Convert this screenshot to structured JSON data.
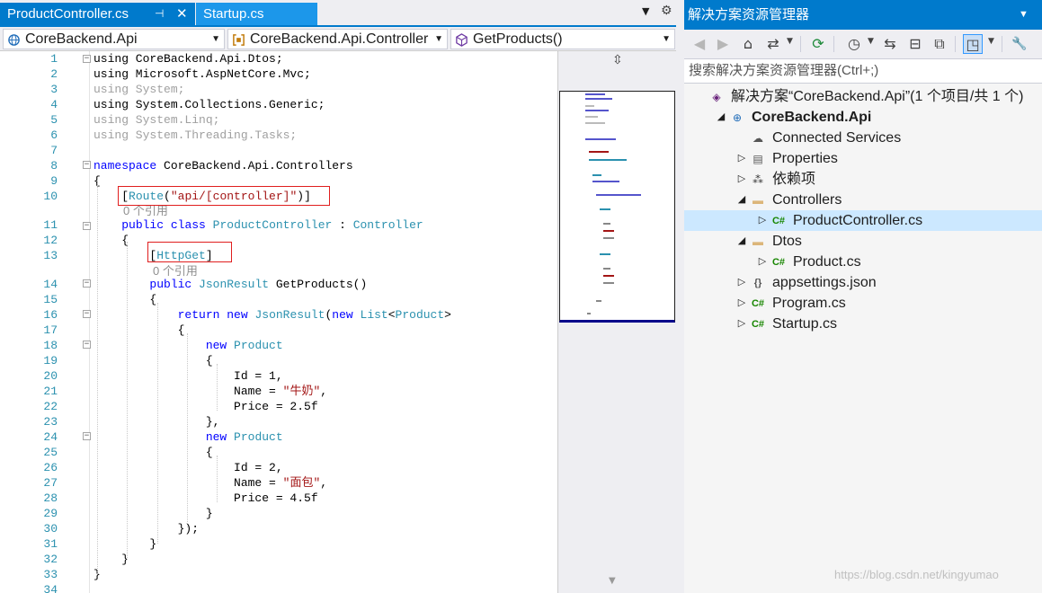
{
  "tabs": {
    "active": "ProductController.cs",
    "second": "Startup.cs",
    "pin_glyph": "⊣",
    "close_glyph": "✕",
    "dropdown_glyph": "▼",
    "gear_glyph": "⚙"
  },
  "navbar": {
    "project": "CoreBackend.Api",
    "namespace": "CoreBackend.Api.Controller",
    "member": "GetProducts()",
    "arrow": "▼"
  },
  "editor": {
    "lines": [
      {
        "n": "1",
        "segs": [
          [
            "using CoreBackend.Api.Dtos;",
            ""
          ]
        ]
      },
      {
        "n": "2",
        "segs": [
          [
            "using Microsoft.AspNetCore.Mvc;",
            ""
          ]
        ]
      },
      {
        "n": "3",
        "segs": [
          [
            "using System;",
            "dim"
          ]
        ]
      },
      {
        "n": "4",
        "segs": [
          [
            "using System.Collections.Generic;",
            ""
          ]
        ]
      },
      {
        "n": "5",
        "segs": [
          [
            "using System.Linq;",
            "dim"
          ]
        ]
      },
      {
        "n": "6",
        "segs": [
          [
            "using System.Threading.Tasks;",
            "dim"
          ]
        ]
      },
      {
        "n": "7",
        "segs": []
      },
      {
        "n": "8",
        "segs": [
          [
            "namespace",
            "kw"
          ],
          [
            " CoreBackend.Api.Controllers",
            ""
          ]
        ]
      },
      {
        "n": "9",
        "segs": [
          [
            "{",
            ""
          ]
        ]
      },
      {
        "n": "10",
        "segs": [
          [
            "    [",
            ""
          ],
          [
            "Route",
            "ty"
          ],
          [
            "(",
            ""
          ],
          [
            "\"api/[controller]\"",
            "st"
          ],
          [
            ")]",
            ""
          ]
        ]
      },
      {
        "n": "11",
        "segs": [
          [
            "    ",
            ""
          ],
          [
            "public",
            "kw"
          ],
          [
            " ",
            ""
          ],
          [
            "class",
            "kw"
          ],
          [
            " ",
            ""
          ],
          [
            "ProductController",
            "ty"
          ],
          [
            " : ",
            ""
          ],
          [
            "Controller",
            "ty"
          ]
        ]
      },
      {
        "n": "12",
        "segs": [
          [
            "    {",
            ""
          ]
        ]
      },
      {
        "n": "13",
        "segs": [
          [
            "        [",
            ""
          ],
          [
            "HttpGet",
            "ty"
          ],
          [
            "]",
            ""
          ]
        ]
      },
      {
        "n": "14",
        "segs": [
          [
            "        ",
            ""
          ],
          [
            "public",
            "kw"
          ],
          [
            " ",
            ""
          ],
          [
            "JsonResult",
            "ty"
          ],
          [
            " GetProducts()",
            ""
          ]
        ]
      },
      {
        "n": "15",
        "segs": [
          [
            "        {",
            ""
          ]
        ]
      },
      {
        "n": "16",
        "segs": [
          [
            "            ",
            ""
          ],
          [
            "return",
            "kw"
          ],
          [
            " ",
            ""
          ],
          [
            "new",
            "kw"
          ],
          [
            " ",
            ""
          ],
          [
            "JsonResult",
            "ty"
          ],
          [
            "(",
            ""
          ],
          [
            "new",
            "kw"
          ],
          [
            " ",
            ""
          ],
          [
            "List",
            "ty"
          ],
          [
            "<",
            ""
          ],
          [
            "Product",
            "ty"
          ],
          [
            ">",
            ""
          ]
        ]
      },
      {
        "n": "17",
        "segs": [
          [
            "            {",
            ""
          ]
        ]
      },
      {
        "n": "18",
        "segs": [
          [
            "                ",
            ""
          ],
          [
            "new",
            "kw"
          ],
          [
            " ",
            ""
          ],
          [
            "Product",
            "ty"
          ]
        ]
      },
      {
        "n": "19",
        "segs": [
          [
            "                {",
            ""
          ]
        ]
      },
      {
        "n": "20",
        "segs": [
          [
            "                    Id = 1,",
            ""
          ]
        ]
      },
      {
        "n": "21",
        "segs": [
          [
            "                    Name = ",
            ""
          ],
          [
            "\"牛奶\"",
            "st"
          ],
          [
            ",",
            ""
          ]
        ]
      },
      {
        "n": "22",
        "segs": [
          [
            "                    Price = 2.5f",
            ""
          ]
        ]
      },
      {
        "n": "23",
        "segs": [
          [
            "                },",
            ""
          ]
        ]
      },
      {
        "n": "24",
        "segs": [
          [
            "                ",
            ""
          ],
          [
            "new",
            "kw"
          ],
          [
            " ",
            ""
          ],
          [
            "Product",
            "ty"
          ]
        ]
      },
      {
        "n": "25",
        "segs": [
          [
            "                {",
            ""
          ]
        ]
      },
      {
        "n": "26",
        "segs": [
          [
            "                    Id = 2,",
            ""
          ]
        ]
      },
      {
        "n": "27",
        "segs": [
          [
            "                    Name = ",
            ""
          ],
          [
            "\"面包\"",
            "st"
          ],
          [
            ",",
            ""
          ]
        ]
      },
      {
        "n": "28",
        "segs": [
          [
            "                    Price = 4.5f",
            ""
          ]
        ]
      },
      {
        "n": "29",
        "segs": [
          [
            "                }",
            ""
          ]
        ]
      },
      {
        "n": "30",
        "segs": [
          [
            "            });",
            ""
          ]
        ]
      },
      {
        "n": "31",
        "segs": [
          [
            "        }",
            ""
          ]
        ]
      },
      {
        "n": "32",
        "segs": [
          [
            "    }",
            ""
          ]
        ]
      },
      {
        "n": "33",
        "segs": [
          [
            "}",
            ""
          ]
        ]
      },
      {
        "n": "34",
        "segs": []
      }
    ],
    "ref_hint": "0 个引用"
  },
  "solution_explorer": {
    "title": "解决方案资源管理器",
    "search_placeholder": "搜索解决方案资源管理器(Ctrl+;)",
    "pin": "▼",
    "tree": [
      {
        "label": "解决方案“CoreBackend.Api”(1 个项目/共 1 个)",
        "depth": 0,
        "twisty": "",
        "icon": "solution-icon",
        "bold": false,
        "selected": false
      },
      {
        "label": "CoreBackend.Api",
        "depth": 1,
        "twisty": "◢",
        "icon": "web-project-icon",
        "bold": true,
        "selected": false
      },
      {
        "label": "Connected Services",
        "depth": 2,
        "twisty": "",
        "icon": "cloud-icon",
        "bold": false,
        "selected": false
      },
      {
        "label": "Properties",
        "depth": 2,
        "twisty": "▷",
        "icon": "properties-icon",
        "bold": false,
        "selected": false
      },
      {
        "label": "依赖项",
        "depth": 2,
        "twisty": "▷",
        "icon": "dependencies-icon",
        "bold": false,
        "selected": false
      },
      {
        "label": "Controllers",
        "depth": 2,
        "twisty": "◢",
        "icon": "folder-icon",
        "bold": false,
        "selected": false
      },
      {
        "label": "ProductController.cs",
        "depth": 3,
        "twisty": "▷",
        "icon": "csharp-file-icon",
        "bold": false,
        "selected": true
      },
      {
        "label": "Dtos",
        "depth": 2,
        "twisty": "◢",
        "icon": "folder-icon",
        "bold": false,
        "selected": false
      },
      {
        "label": "Product.cs",
        "depth": 3,
        "twisty": "▷",
        "icon": "csharp-file-icon",
        "bold": false,
        "selected": false
      },
      {
        "label": "appsettings.json",
        "depth": 2,
        "twisty": "▷",
        "icon": "json-file-icon",
        "bold": false,
        "selected": false
      },
      {
        "label": "Program.cs",
        "depth": 2,
        "twisty": "▷",
        "icon": "csharp-file-icon",
        "bold": false,
        "selected": false
      },
      {
        "label": "Startup.cs",
        "depth": 2,
        "twisty": "▷",
        "icon": "csharp-file-icon",
        "bold": false,
        "selected": false
      }
    ]
  },
  "toolbar": {
    "back": "◀",
    "forward": "▶",
    "home": "⌂",
    "switch_views": "⇄",
    "pending_changes": "⟳",
    "history": "◷",
    "sync": "⇆",
    "collapse": "⊟",
    "show_all": "⧉",
    "preview": "◳",
    "properties": "🔧"
  },
  "watermark": "https://blog.csdn.net/kingyumao",
  "colors": {
    "accent": "#007acc",
    "tab_inactive": "#1c97ea",
    "keyword": "#0000ff",
    "type": "#2b91af",
    "string": "#a31515",
    "highlight_box": "#e01e1e",
    "selection": "#cce8ff"
  }
}
